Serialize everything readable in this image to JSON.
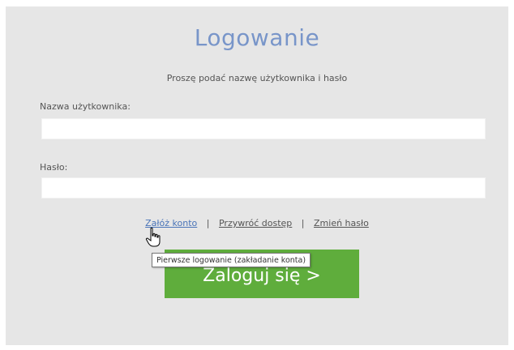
{
  "login": {
    "title": "Logowanie",
    "subtitle": "Proszę podać nazwę użytkownika i hasło",
    "username_label": "Nazwa użytkownika:",
    "username_value": "",
    "password_label": "Hasło:",
    "password_value": "",
    "links": {
      "create_account": "Załóż konto",
      "separator": "|",
      "restore_access": "Przywróć dostęp",
      "change_password": "Zmień hasło"
    },
    "tooltip": "Pierwsze logowanie (zakładanie konta)",
    "submit_label": "Zaloguj się >"
  },
  "colors": {
    "title": "#7895c9",
    "button": "#5fad3c",
    "panel": "#e6e6e6",
    "link_active": "#4a74b8"
  },
  "icons": {
    "cursor": "hand-pointer-icon"
  }
}
